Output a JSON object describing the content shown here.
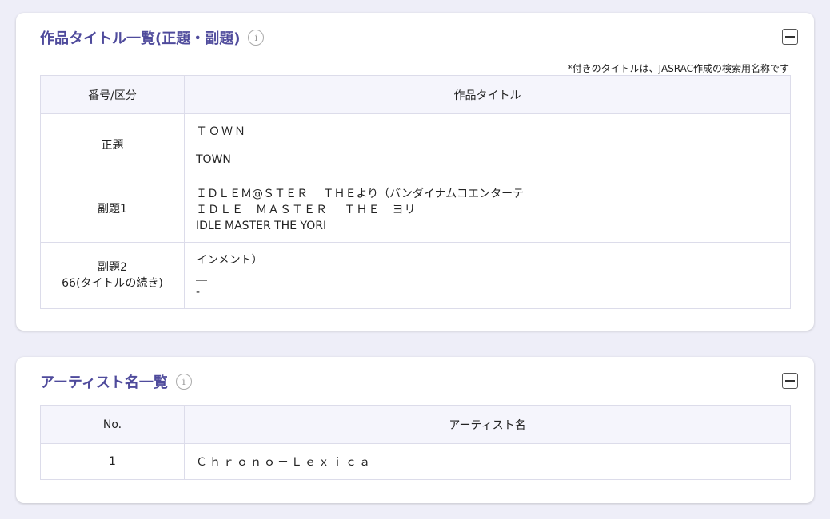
{
  "works": {
    "title": "作品タイトル一覧(正題・副題)",
    "note": "*付きのタイトルは、JASRAC作成の検索用名称です",
    "col_kind": "番号/区分",
    "col_title": "作品タイトル",
    "rows": [
      {
        "kind": "正題",
        "kind2": "",
        "lines": [
          "ＴＯＷＮ",
          "TOWN"
        ]
      },
      {
        "kind": "副題1",
        "kind2": "",
        "lines": [
          "ＩＤＬＥＭ@ＳＴＥＲ　 ＴＨＥより（バンダイナムコエンターテ",
          "ＩＤＬＥ　ＭＡＳＴＥＲ　 ＴＨＥ　ヨリ",
          "IDLE MASTER THE YORI"
        ]
      },
      {
        "kind": "副題2",
        "kind2": "66(タイトルの続き)",
        "lines": [
          "インメント）",
          "＿",
          "-"
        ]
      }
    ]
  },
  "artists": {
    "title": "アーティスト名一覧",
    "col_no": "No.",
    "col_name": "アーティスト名",
    "rows": [
      {
        "no": "1",
        "name": "Ｃｈｒｏｎｏ－Ｌｅｘｉｃａ"
      }
    ]
  },
  "icons": {
    "info": "info-icon",
    "collapse": "collapse-icon"
  }
}
